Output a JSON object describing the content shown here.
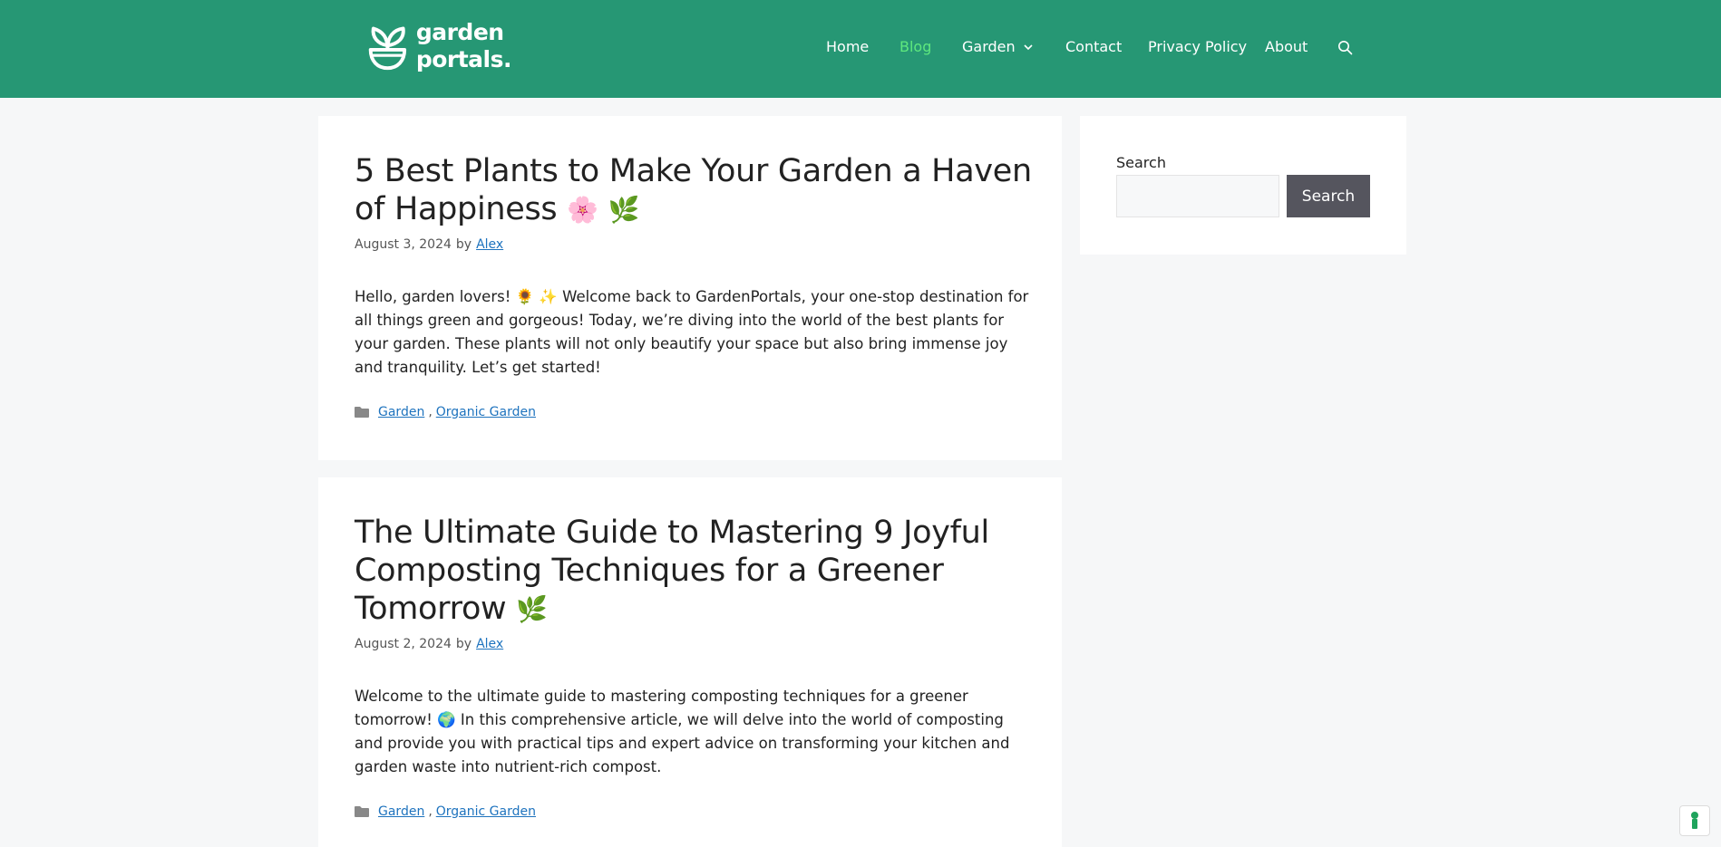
{
  "header": {
    "logo_line1": "garden",
    "logo_line2": "portals.",
    "nav": [
      {
        "label": "Home"
      },
      {
        "label": "Blog"
      },
      {
        "label": "Garden"
      },
      {
        "label": "Contact"
      },
      {
        "label": "Privacy Policy"
      },
      {
        "label": "About"
      }
    ],
    "colors": {
      "background": "#269774",
      "active": "#5ee87e",
      "text": "#ffffff"
    }
  },
  "posts": [
    {
      "title": "5 Best Plants to Make Your Garden a Haven of Happiness",
      "title_emojis": [
        "🌸",
        "🌿"
      ],
      "date": "August 3, 2024",
      "by": "by",
      "author": "Alex",
      "excerpt": "Hello, garden lovers! 🌻 ✨ Welcome back to GardenPortals, your one-stop destination for all things green and gorgeous! Today, we’re diving into the world of the best plants for your garden. These plants will not only beautify your space but also bring immense joy and tranquility. Let’s get started!",
      "categories": [
        "Garden",
        "Organic Garden"
      ],
      "separator": ","
    },
    {
      "title": "The Ultimate Guide to Mastering 9 Joyful Composting Techniques for a Greener Tomorrow",
      "title_emojis": [
        "🌿"
      ],
      "date": "August 2, 2024",
      "by": "by",
      "author": "Alex",
      "excerpt": "Welcome to the ultimate guide to mastering composting techniques for a greener tomorrow! 🌍 In this comprehensive article, we will delve into the world of composting and provide you with practical tips and expert advice on transforming your kitchen and garden waste into nutrient-rich compost.",
      "categories": [
        "Garden",
        "Organic Garden"
      ],
      "separator": ","
    }
  ],
  "sidebar": {
    "search_label": "Search",
    "search_value": "",
    "search_button": "Search"
  },
  "icons": {
    "nav_search": "search-icon",
    "nav_dropdown": "chevron-down-icon",
    "category": "folder-icon",
    "badge": "privacy-badge-icon"
  }
}
